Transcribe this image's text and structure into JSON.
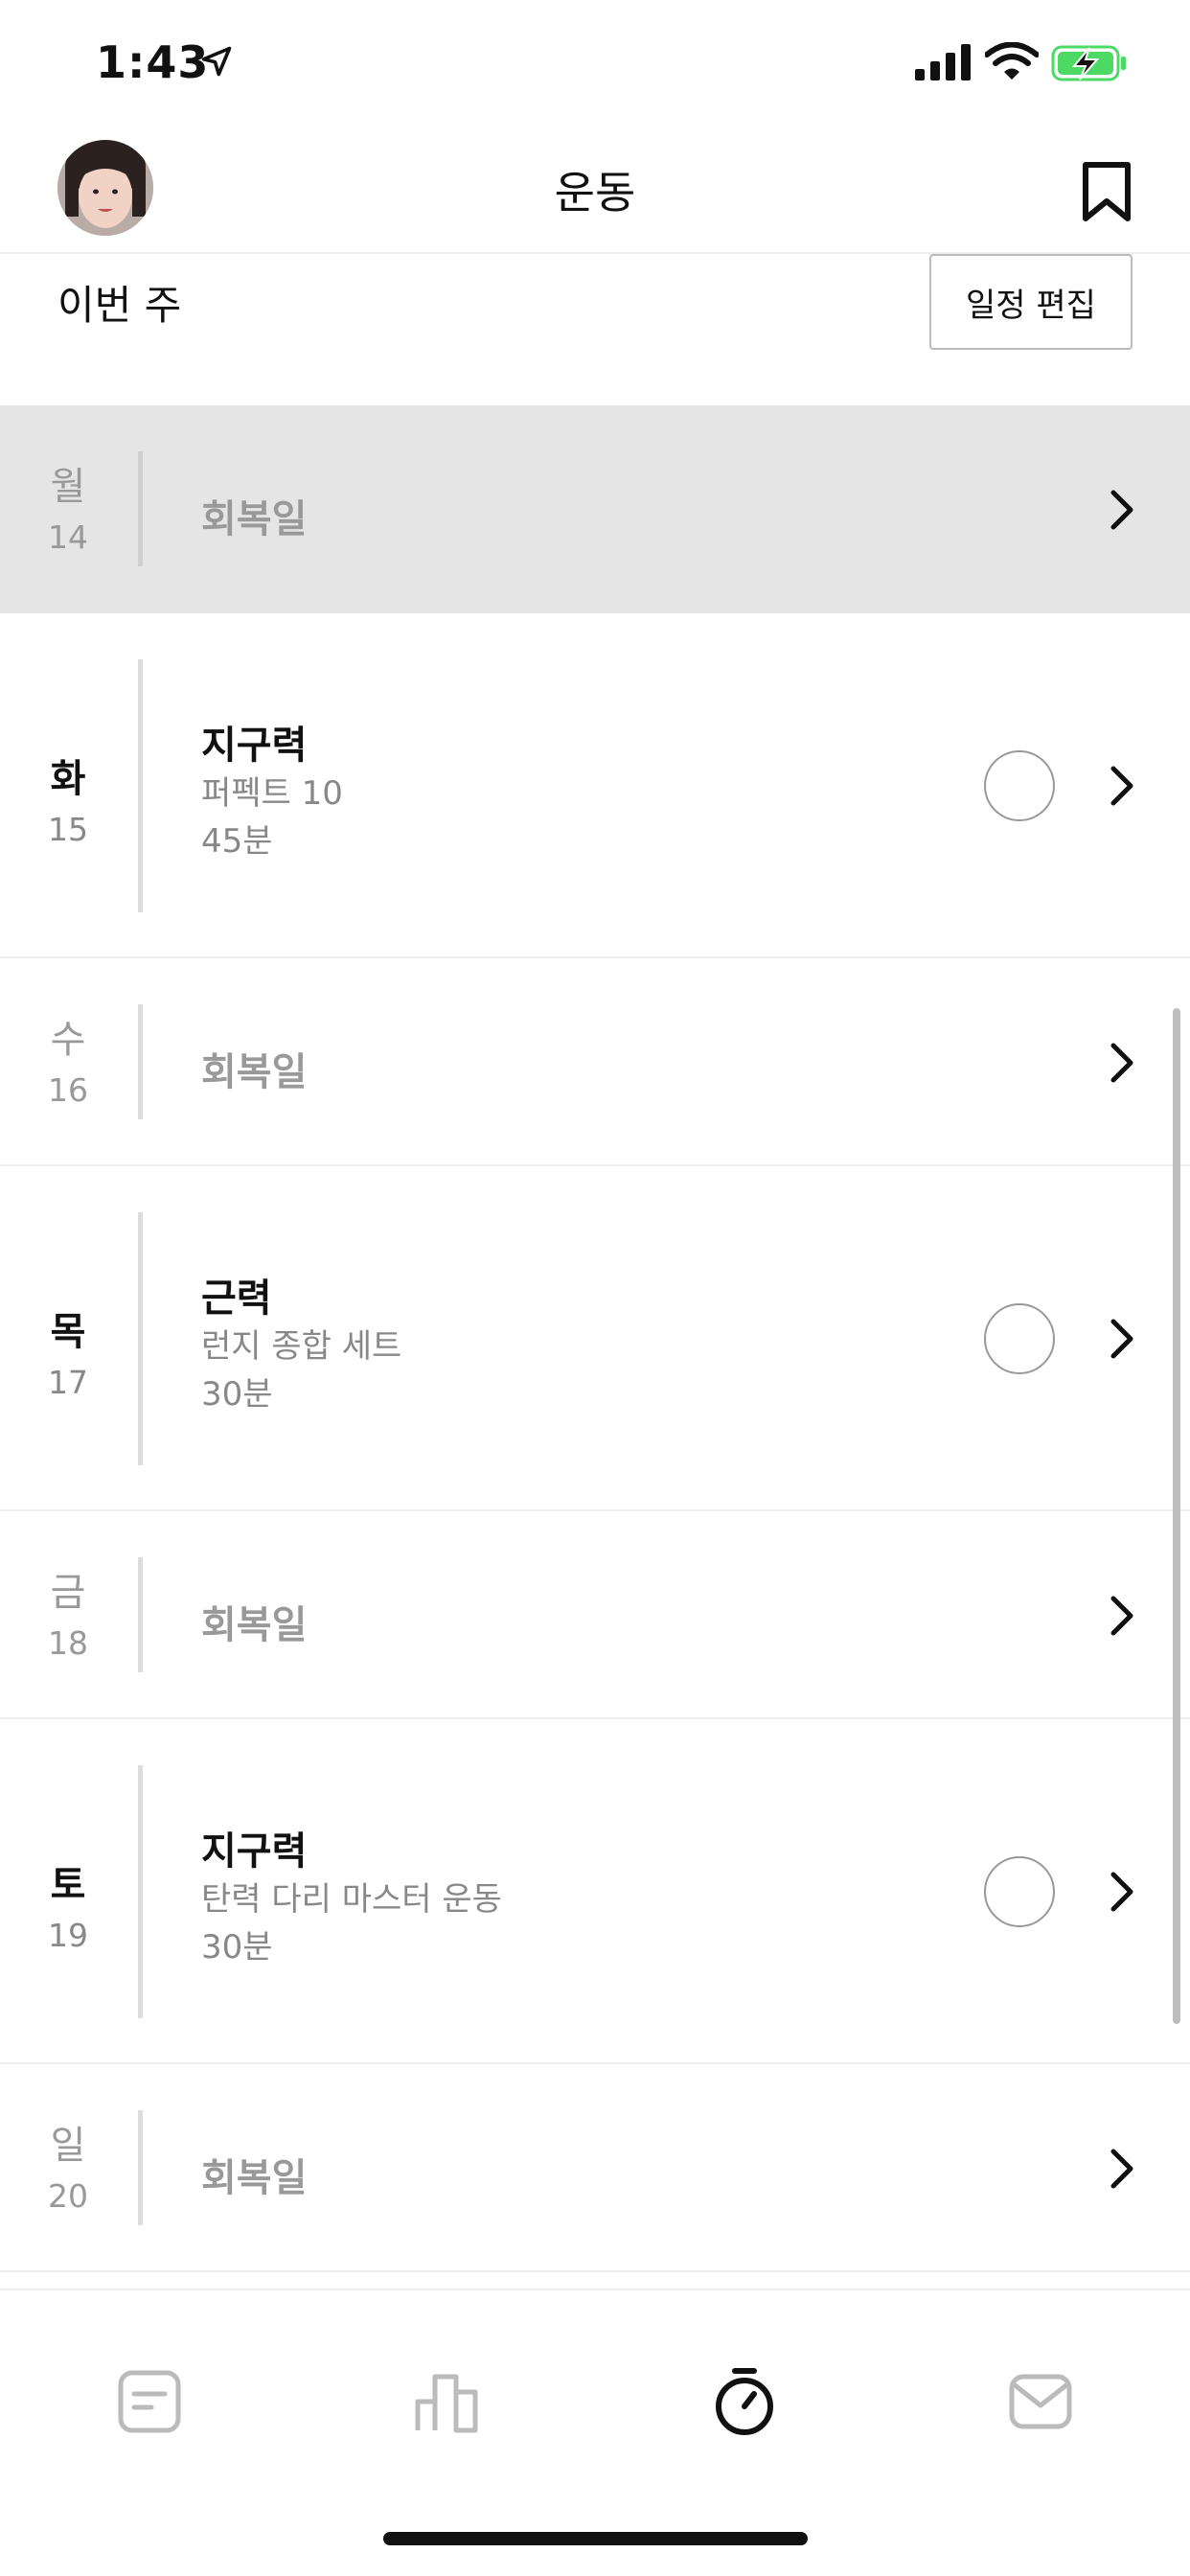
{
  "status_bar": {
    "time": "1:43"
  },
  "header": {
    "title": "운동"
  },
  "week": {
    "label": "이번 주",
    "edit_button": "일정 편집"
  },
  "days": [
    {
      "day": "월",
      "date": "14",
      "type": "rest",
      "label": "회복일",
      "selected": true
    },
    {
      "day": "화",
      "date": "15",
      "type": "workout",
      "title": "지구력",
      "subtitle": "퍼펙트 10",
      "duration": "45분"
    },
    {
      "day": "수",
      "date": "16",
      "type": "rest",
      "label": "회복일"
    },
    {
      "day": "목",
      "date": "17",
      "type": "workout",
      "title": "근력",
      "subtitle": "런지 종합 세트",
      "duration": "30분"
    },
    {
      "day": "금",
      "date": "18",
      "type": "rest",
      "label": "회복일"
    },
    {
      "day": "토",
      "date": "19",
      "type": "workout",
      "title": "지구력",
      "subtitle": "탄력 다리 마스터 운동",
      "duration": "30분"
    },
    {
      "day": "일",
      "date": "20",
      "type": "rest",
      "label": "회복일"
    }
  ],
  "tabs": [
    {
      "icon": "feed-icon",
      "active": false
    },
    {
      "icon": "progress-chart-icon",
      "active": false
    },
    {
      "icon": "stopwatch-icon",
      "active": true
    },
    {
      "icon": "inbox-icon",
      "active": false
    }
  ],
  "colors": {
    "selected_row_bg": "#e5e5e5",
    "muted_text": "#999999",
    "battery_green": "#4cd964"
  }
}
